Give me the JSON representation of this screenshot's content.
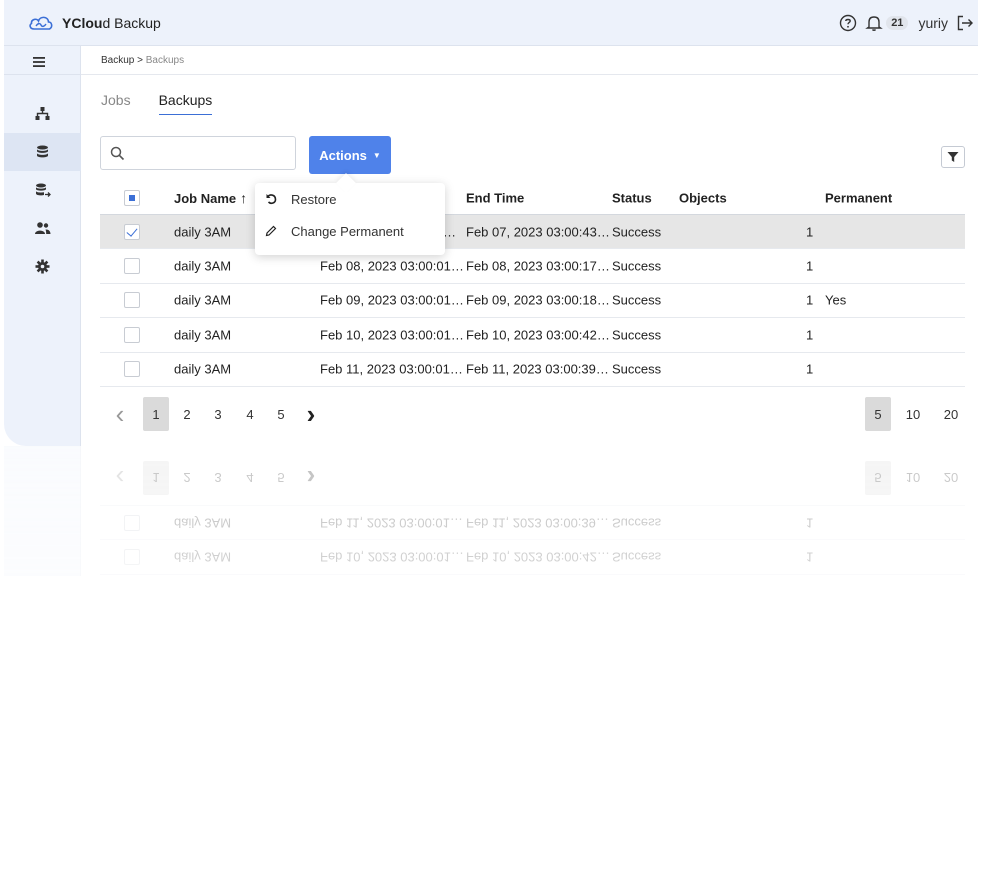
{
  "app": {
    "brand_bold": "YClou",
    "brand_rest": "d Backup",
    "notification_count": "21",
    "username": "yuriy"
  },
  "icons": {
    "logo": "cloud-logo-icon",
    "help": "help-circle-icon",
    "bell": "bell-icon",
    "logout": "logout-icon",
    "menu": "hamburger-menu-icon",
    "sidebar": [
      "sitemap-icon",
      "database-icon",
      "database-sync-icon",
      "users-icon",
      "gear-icon"
    ],
    "search": "search-icon",
    "filter": "filter-icon",
    "restore": "undo-icon",
    "edit": "pencil-icon"
  },
  "colors": {
    "accent": "#4f82ea",
    "topbar_bg": "#edf2fb",
    "selected_row": "#e6e6e6"
  },
  "breadcrumb": {
    "root": "Backup",
    "separator": " > ",
    "current": "Backups"
  },
  "tabs": [
    {
      "label": "Jobs",
      "active": false
    },
    {
      "label": "Backups",
      "active": true
    }
  ],
  "search": {
    "value": "",
    "placeholder": ""
  },
  "actions": {
    "label": "Actions",
    "menu": [
      {
        "label": "Restore",
        "icon": "undo-icon"
      },
      {
        "label": "Change Permanent",
        "icon": "pencil-icon"
      }
    ]
  },
  "table": {
    "columns": {
      "job": "Job Name",
      "sort_arrow": "↑",
      "end": "End Time",
      "status": "Status",
      "objects": "Objects",
      "permanent": "Permanent"
    },
    "rows": [
      {
        "job": "daily 3AM",
        "start": "…",
        "end": "Feb 07, 2023 03:00:43…",
        "status": "Success",
        "count": "1",
        "permanent": "",
        "checked": true
      },
      {
        "job": "daily 3AM",
        "start": "Feb 08, 2023 03:00:01…",
        "end": "Feb 08, 2023 03:00:17…",
        "status": "Success",
        "count": "1",
        "permanent": "",
        "checked": false
      },
      {
        "job": "daily 3AM",
        "start": "Feb 09, 2023 03:00:01…",
        "end": "Feb 09, 2023 03:00:18…",
        "status": "Success",
        "count": "1",
        "permanent": "Yes",
        "checked": false
      },
      {
        "job": "daily 3AM",
        "start": "Feb 10, 2023 03:00:01…",
        "end": "Feb 10, 2023 03:00:42…",
        "status": "Success",
        "count": "1",
        "permanent": "",
        "checked": false
      },
      {
        "job": "daily 3AM",
        "start": "Feb 11, 2023 03:00:01…",
        "end": "Feb 11, 2023 03:00:39…",
        "status": "Success",
        "count": "1",
        "permanent": "",
        "checked": false
      }
    ]
  },
  "pagination": {
    "prev": "‹",
    "next": "›",
    "pages": [
      "1",
      "2",
      "3",
      "4",
      "5"
    ],
    "active_page": "1",
    "sizes": [
      "5",
      "10",
      "20"
    ],
    "active_size": "5"
  }
}
